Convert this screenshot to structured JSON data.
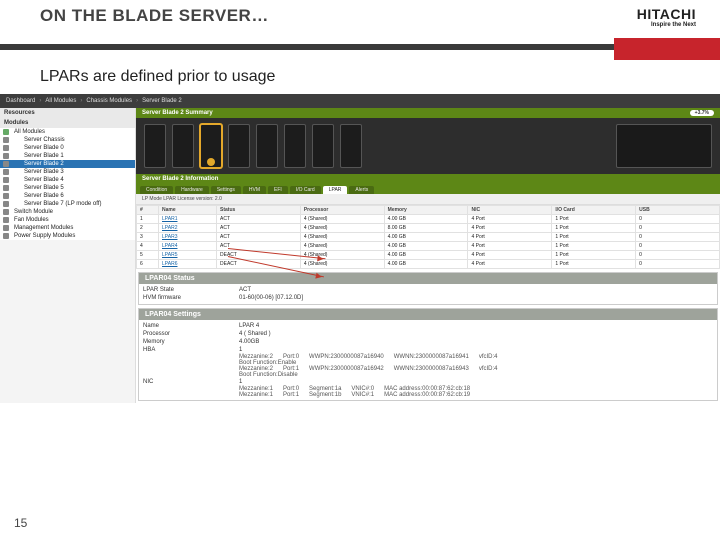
{
  "slide": {
    "title": "ON THE BLADE SERVER…",
    "subtitle": "LPARs are defined prior to usage",
    "page": "15"
  },
  "brand": {
    "name": "HITACHI",
    "tagline": "Inspire the Next"
  },
  "toolbar": {
    "items": [
      "Dashboard",
      "All Modules",
      "Chassis Modules",
      "Server Blade 2"
    ]
  },
  "sidebar": {
    "resources": "Resources",
    "modules": "Modules",
    "items": [
      {
        "label": "All Modules",
        "root": true
      },
      {
        "label": "Server Chassis",
        "indent": true
      },
      {
        "label": "Server Blade 0",
        "indent": true
      },
      {
        "label": "Server Blade 1",
        "indent": true
      },
      {
        "label": "Server Blade 2",
        "indent": true,
        "active": true
      },
      {
        "label": "Server Blade 3",
        "indent": true
      },
      {
        "label": "Server Blade 4",
        "indent": true
      },
      {
        "label": "Server Blade 5",
        "indent": true
      },
      {
        "label": "Server Blade 6",
        "indent": true
      },
      {
        "label": "Server Blade 7 (LP mode off)",
        "indent": true
      },
      {
        "label": "Switch Module"
      },
      {
        "label": "Fan Modules"
      },
      {
        "label": "Management Modules"
      },
      {
        "label": "Power Supply Modules"
      }
    ]
  },
  "main": {
    "summary_title": "Server Blade 2 Summary",
    "info_title": "Server Blade 2 Information",
    "tabs": [
      "Condition",
      "Hardware",
      "Settings",
      "HVM",
      "EFI",
      "I/O Card",
      "LPAR",
      "Alerts"
    ],
    "active_tab": "LPAR",
    "mode_line": "LP Mode LPAR License version: 2.0",
    "cols": [
      "#",
      "Name",
      "Status",
      "Processor",
      "Memory",
      "NIC",
      "I/O Card",
      "USB"
    ],
    "rows": [
      {
        "n": "1",
        "name": "LPAR1",
        "status": "ACT",
        "proc": "4 (Shared)",
        "mem": "4.00 GB",
        "nic": "4 Port",
        "io": "1 Port",
        "usb": "0"
      },
      {
        "n": "2",
        "name": "LPAR2",
        "status": "ACT",
        "proc": "4 (Shared)",
        "mem": "8.00 GB",
        "nic": "4 Port",
        "io": "1 Port",
        "usb": "0"
      },
      {
        "n": "3",
        "name": "LPAR3",
        "status": "ACT",
        "proc": "4 (Shared)",
        "mem": "4.00 GB",
        "nic": "4 Port",
        "io": "1 Port",
        "usb": "0"
      },
      {
        "n": "4",
        "name": "LPAR4",
        "status": "ACT",
        "proc": "4 (Shared)",
        "mem": "4.00 GB",
        "nic": "4 Port",
        "io": "1 Port",
        "usb": "0"
      },
      {
        "n": "5",
        "name": "LPAR5",
        "status": "DEACT",
        "proc": "4 (Shared)",
        "mem": "4.00 GB",
        "nic": "4 Port",
        "io": "1 Port",
        "usb": "0"
      },
      {
        "n": "6",
        "name": "LPAR6",
        "status": "DEACT",
        "proc": "4 (Shared)",
        "mem": "4.00 GB",
        "nic": "4 Port",
        "io": "1 Port",
        "usb": "0"
      }
    ],
    "status_badge": "+3.7%"
  },
  "status_panel": {
    "title": "LPAR04 Status",
    "state_label": "LPAR State",
    "state_value": "ACT",
    "fw_label": "HVM firmware",
    "fw_value": "01-60(00-06) [07.12.0D]"
  },
  "settings_panel": {
    "title": "LPAR04 Settings",
    "name_label": "Name",
    "name_value": "LPAR 4",
    "proc_label": "Processor",
    "proc_value": "4 ( Shared )",
    "mem_label": "Memory",
    "mem_value": "4.00GB",
    "hba_label": "HBA",
    "hba_count": "1",
    "hba_line1": {
      "mez": "Mezzanine:2",
      "port": "Port:0",
      "wwpn": "WWPN:2300000087a16940",
      "wwnn": "WWNN:2300000087a16941",
      "vfc": "vfcID:4"
    },
    "hba_bf1": "Boot Function:Enable",
    "hba_line2": {
      "mez": "Mezzanine:2",
      "port": "Port:1",
      "wwpn": "WWPN:2300000087a16942",
      "wwnn": "WWNN:2300000087a16943",
      "vfc": "vfcID:4"
    },
    "hba_bf2": "Boot Function:Disable",
    "nic_label": "NIC",
    "nic_count": "1",
    "nic_line1": {
      "mez": "Mezzanine:1",
      "port": "Port:0",
      "seg": "Segment:1a",
      "vnic": "VNIC#:0",
      "mac": "MAC address:00:00:87:62:cb:18"
    },
    "nic_line2": {
      "mez": "Mezzanine:1",
      "port": "Port:1",
      "seg": "Segment:1b",
      "vnic": "VNIC#:1",
      "mac": "MAC address:00:00:87:62:cb:19"
    }
  }
}
